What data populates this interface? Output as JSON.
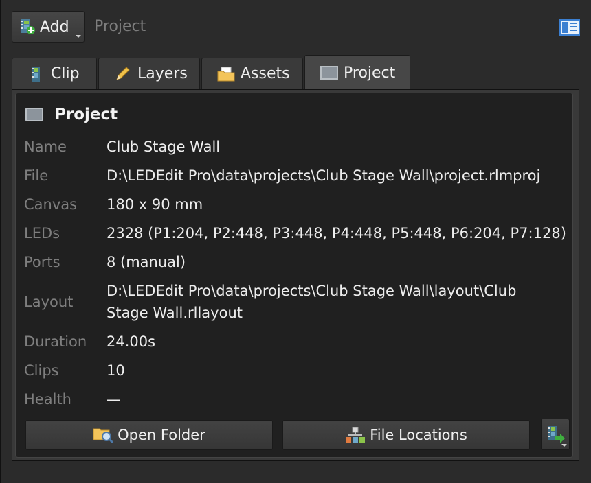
{
  "toolbar": {
    "add_label": "Add",
    "breadcrumb": "Project",
    "add_icon": "add-clip-icon",
    "layout_icon": "panel-layout-icon"
  },
  "tabs": [
    {
      "label": "Clip",
      "icon": "film-strip-icon",
      "active": false
    },
    {
      "label": "Layers",
      "icon": "pencil-icon",
      "active": false
    },
    {
      "label": "Assets",
      "icon": "folder-icon",
      "active": false
    },
    {
      "label": "Project",
      "icon": "monitor-icon",
      "active": true
    }
  ],
  "project": {
    "title": "Project",
    "fields": [
      {
        "key": "Name",
        "value": "Club Stage Wall"
      },
      {
        "key": "File",
        "value": "D:\\LEDEdit Pro\\data\\projects\\Club Stage Wall\\project.rlmproj"
      },
      {
        "key": "Canvas",
        "value": "180 x 90 mm"
      },
      {
        "key": "LEDs",
        "value": "2328 (P1:204, P2:448, P3:448, P4:448, P5:448, P6:204, P7:128)"
      },
      {
        "key": "Ports",
        "value": "8 (manual)"
      },
      {
        "key": "Layout",
        "value": "D:\\LEDEdit Pro\\data\\projects\\Club Stage Wall\\layout\\Club",
        "value2": "Stage Wall.rllayout"
      },
      {
        "key": "Duration",
        "value": "24.00s"
      },
      {
        "key": "Clips",
        "value": "10"
      },
      {
        "key": "Health",
        "value": "—"
      }
    ]
  },
  "actions": {
    "open_folder": "Open Folder",
    "file_locations": "File Locations",
    "export_icon": "export-icon"
  },
  "colors": {
    "background": "#2b2b2b",
    "panel": "#202020",
    "label": "#7e7e7e",
    "value": "#ededed"
  }
}
